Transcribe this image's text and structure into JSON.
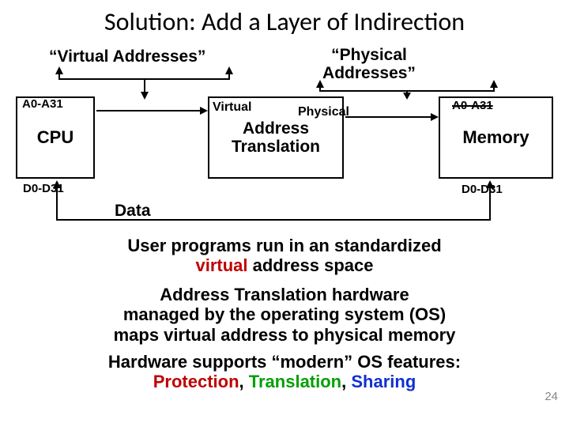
{
  "title": "Solution:  Add a Layer of Indirection",
  "labels": {
    "virtual": "“Virtual Addresses”",
    "physical_l1": "“Physical",
    "physical_l2": "Addresses”"
  },
  "boxes": {
    "cpu": "CPU",
    "trans_l1": "Address",
    "trans_l2": "Translation",
    "memory": "Memory"
  },
  "ann": {
    "a_left": "A0-A31",
    "a_right": "A0-A31",
    "d_left": "D0-D31",
    "d_right": "D0-D31",
    "virtual": "Virtual",
    "physical": "Physical",
    "data": "Data"
  },
  "body": {
    "p1a": "User programs run in an standardized",
    "p1b_red": "virtual",
    "p1b_rest": " address space",
    "p2a": "Address Translation hardware",
    "p2b": "managed by the operating system (OS)",
    "p2c": "maps virtual address to physical memory",
    "p3a": "Hardware supports “modern” OS features:",
    "p3_prot": "Protection",
    "p3_sep1": ", ",
    "p3_trans": "Translation",
    "p3_sep2": ", ",
    "p3_share": "Sharing"
  },
  "pagenum": "24"
}
